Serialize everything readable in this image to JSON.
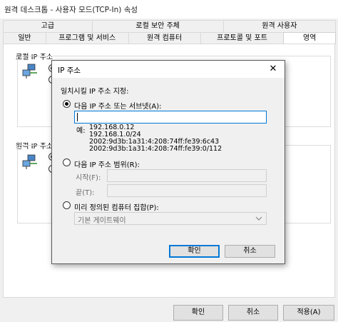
{
  "window": {
    "title": "원격 데스크톱 - 사용자 모드(TCP-In) 속성"
  },
  "tabs_top": [
    "고급",
    "로컬 보안 주체",
    "원격 사용자"
  ],
  "tabs_bottom": [
    "일반",
    "프로그램 및 서비스",
    "원격 컴퓨터",
    "프로토콜 및 포트",
    "영역"
  ],
  "active_tab": "영역",
  "background": {
    "local_group_label": "로컬 IP 주소",
    "remote_group_label": "원격 IP 주소"
  },
  "outer_buttons": {
    "ok": "확인",
    "cancel": "취소",
    "apply": "적용(A)"
  },
  "dialog": {
    "title": "IP 주소",
    "close_glyph": "✕",
    "prompt": "일치시킬 IP 주소 지정:",
    "option_address": "다음 IP 주소 또는 서브넷(A):",
    "address_value": "",
    "example_prefix": "예:",
    "examples": [
      "192.168.0.12",
      "192.168.1.0/24",
      "2002:9d3b:1a31:4:208:74ff:fe39:6c43",
      "2002:9d3b:1a31:4:208:74ff:fe39:0/112"
    ],
    "option_range": "다음 IP 주소 범위(R):",
    "range_start_label": "시작(F):",
    "range_end_label": "끝(T):",
    "option_predefined": "미리 정의된 컴퓨터 집합(P):",
    "predefined_value": "기본 게이트웨이",
    "ok": "확인",
    "cancel": "취소",
    "selected_option": "address"
  },
  "colors": {
    "focus_blue": "#0078d7",
    "window_bg": "#f0f0f0"
  }
}
